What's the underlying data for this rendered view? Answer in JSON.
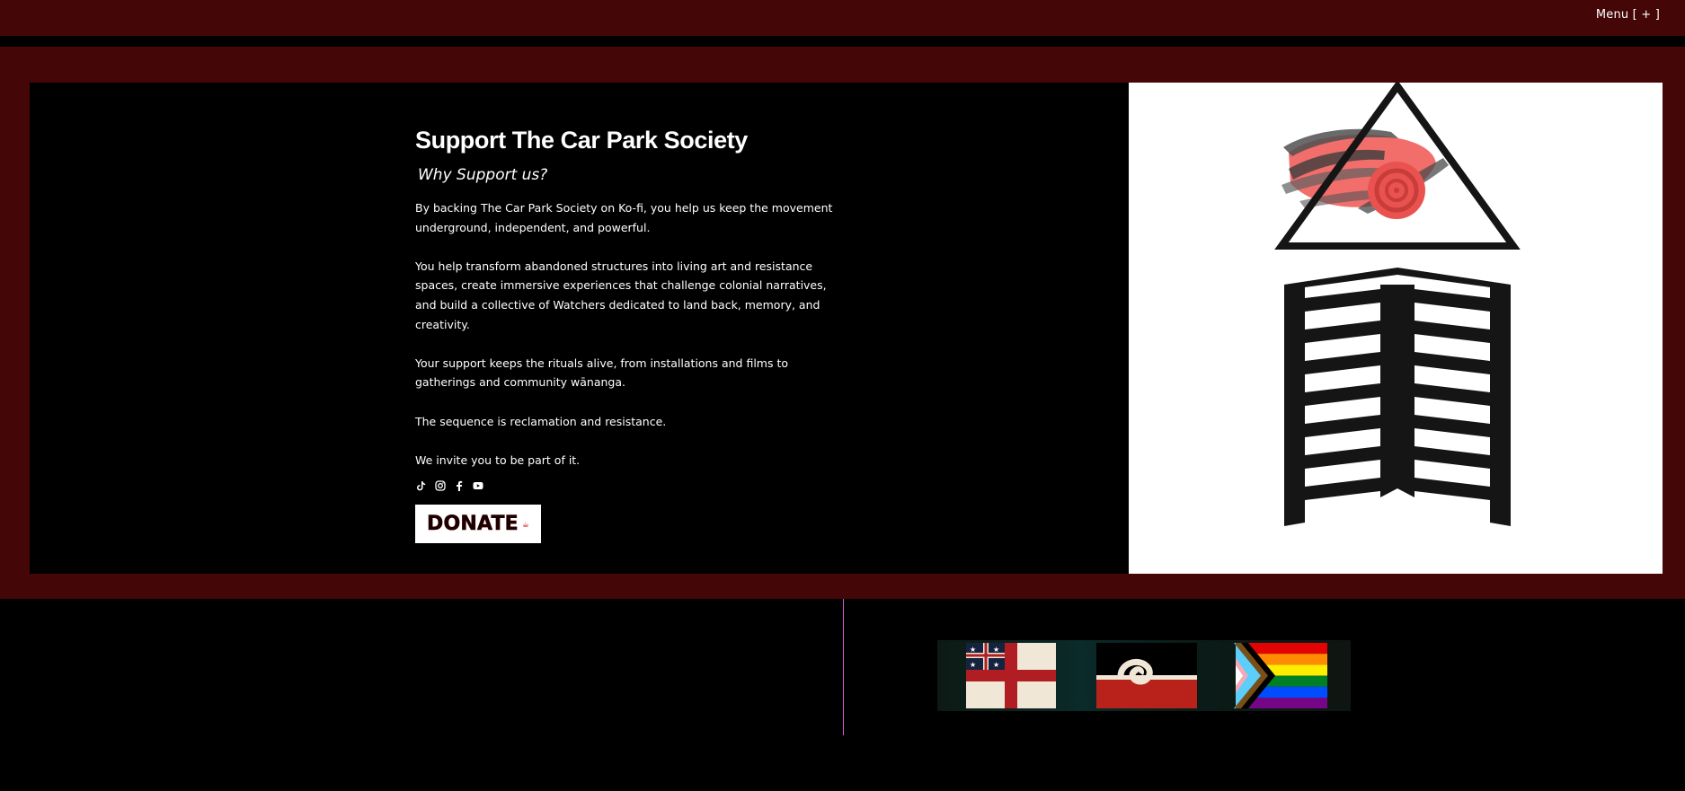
{
  "header": {
    "menu_label": "Menu [ + ]"
  },
  "support": {
    "title": "Support The Car Park Society",
    "subtitle": "Why Support us?",
    "paragraphs": [
      "By backing The Car Park Society on Ko-fi, you help us keep the movement underground, independent, and powerful.",
      "You help transform abandoned structures into living art and resistance spaces, create immersive experiences that challenge colonial narratives, and build a collective of Watchers dedicated to land back, memory, and creativity.",
      "Your support keeps the rituals alive, from installations and films to gatherings and community wānanga.",
      "The sequence is reclamation and resistance.",
      "We invite you to be part of it."
    ],
    "socials": [
      "tiktok-icon",
      "instagram-icon",
      "facebook-icon",
      "youtube-icon"
    ],
    "donate_label": "DONATE"
  },
  "colors": {
    "brand_maroon": "#440607",
    "logo_red": "#f0625e",
    "logo_black": "#151515",
    "divider_pink": "#d35ad6"
  }
}
